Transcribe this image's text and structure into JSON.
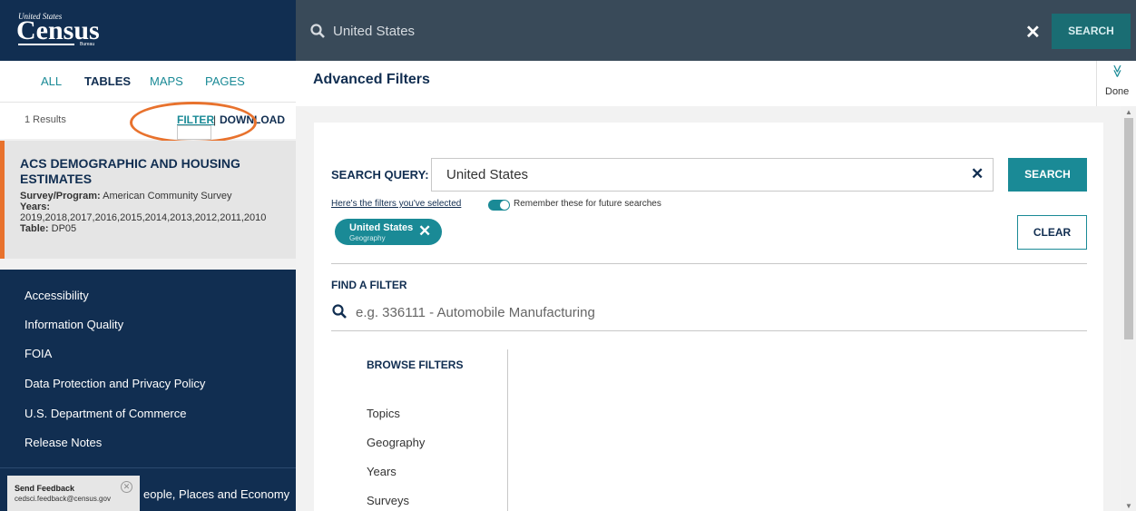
{
  "header": {
    "logo_top": "United States",
    "logo_main": "Census",
    "logo_bottom": "Bureau",
    "search_value": "United States",
    "search_button": "SEARCH",
    "clear_glyph": "✕"
  },
  "left": {
    "tabs": [
      "ALL",
      "TABLES",
      "MAPS",
      "PAGES"
    ],
    "active_tab": "TABLES",
    "results_count": "1 Results",
    "filter_link": "FILTER",
    "separator": "|",
    "download_link": "DOWNLOAD",
    "result": {
      "title": "ACS DEMOGRAPHIC AND HOUSING ESTIMATES",
      "survey_label": "Survey/Program:",
      "survey_value": "American Community Survey",
      "years_label": "Years:",
      "years_value": "2019,2018,2017,2016,2015,2014,2013,2012,2011,2010",
      "table_label": "Table:",
      "table_value": "DP05"
    },
    "nav": [
      "Accessibility",
      "Information Quality",
      "FOIA",
      "Data Protection and Privacy Policy",
      "U.S. Department of Commerce",
      "Release Notes"
    ],
    "nav_bottom": "eople, Places and Economy",
    "feedback": {
      "title": "Send Feedback",
      "email": "cedsci.feedback@census.gov",
      "close": "✕"
    }
  },
  "main": {
    "title": "Advanced Filters",
    "done_label": "Done",
    "done_glyph": "≫",
    "search_query_label": "SEARCH QUERY:",
    "search_query_value": "United States",
    "search_button": "SEARCH",
    "selected_text": "Here's the filters you've selected",
    "remember_text": "Remember these for future searches",
    "chip": {
      "title": "United States",
      "subtitle": "Geography",
      "remove": "✕"
    },
    "clear_button": "CLEAR",
    "find_filter_label": "FIND A FILTER",
    "find_filter_placeholder": "e.g. 336111 - Automobile Manufacturing",
    "browse_title": "BROWSE FILTERS",
    "browse_items": [
      "Topics",
      "Geography",
      "Years",
      "Surveys"
    ]
  },
  "colors": {
    "navy": "#112e51",
    "teal": "#1a8a96",
    "orange_highlight": "#e8722d",
    "search_bar": "#394a59"
  }
}
